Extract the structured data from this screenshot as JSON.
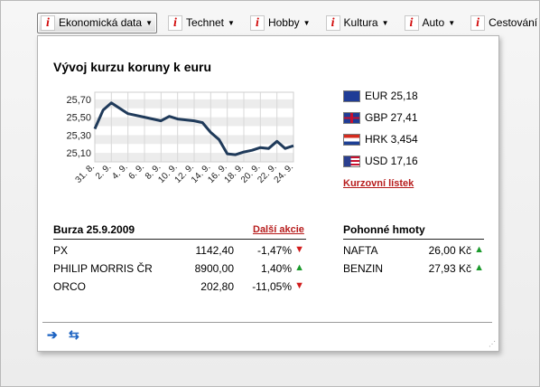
{
  "toolbar": {
    "items": [
      {
        "label": "Ekonomická data",
        "active": true
      },
      {
        "label": "Technet"
      },
      {
        "label": "Hobby"
      },
      {
        "label": "Kultura"
      },
      {
        "label": "Auto"
      },
      {
        "label": "Cestování"
      }
    ],
    "dropdown_glyph": "▼",
    "badge_glyph": "i"
  },
  "panel": {
    "title": "Vývoj kurzu koruny k euru",
    "chart_data": {
      "type": "line",
      "title": "Vývoj kurzu koruny k euru",
      "categories": [
        "31. 8.",
        "2. 9.",
        "4. 9.",
        "6. 9.",
        "8. 9.",
        "10. 9.",
        "12. 9.",
        "14. 9.",
        "16. 9.",
        "18. 9.",
        "20. 9.",
        "22. 9.",
        "24. 9."
      ],
      "x": [
        31,
        32,
        33,
        35,
        37,
        39,
        40,
        41,
        43,
        44,
        45,
        46,
        47,
        48,
        49,
        50,
        51,
        52,
        53,
        54,
        55
      ],
      "series": [
        {
          "values": [
            25.37,
            25.58,
            25.66,
            25.54,
            25.5,
            25.46,
            25.51,
            25.48,
            25.46,
            25.44,
            25.33,
            25.25,
            25.09,
            25.08,
            25.11,
            25.13,
            25.16,
            25.15,
            25.23,
            25.15,
            25.18
          ]
        }
      ],
      "y_ticks": [
        "25,70",
        "25,50",
        "25,30",
        "25,10"
      ],
      "ylim": [
        25.0,
        25.78
      ],
      "grid": true,
      "color": "#1f3a5a"
    },
    "currencies": [
      {
        "flag": "eu-flag",
        "text": "EUR 25,18"
      },
      {
        "flag": "gb-flag",
        "text": "GBP 27,41"
      },
      {
        "flag": "hr-flag",
        "text": "HRK 3,454"
      },
      {
        "flag": "us-flag",
        "text": "USD 17,16"
      }
    ],
    "currency_link": "Kurzovní lístek",
    "stocks": {
      "title": "Burza 25.9.2009",
      "more_link": "Další akcie",
      "rows": [
        {
          "name": "PX",
          "value": "1142,40",
          "change": "-1,47%",
          "dir": "down"
        },
        {
          "name": "PHILIP MORRIS ČR",
          "value": "8900,00",
          "change": "1,40%",
          "dir": "up"
        },
        {
          "name": "ORCO",
          "value": "202,80",
          "change": "-11,05%",
          "dir": "down"
        }
      ]
    },
    "fuels": {
      "title": "Pohonné hmoty",
      "rows": [
        {
          "name": "NAFTA",
          "value": "26,00 Kč",
          "dir": "up"
        },
        {
          "name": "BENZIN",
          "value": "27,93 Kč",
          "dir": "up"
        }
      ]
    },
    "footer": {
      "arrow_glyph": "➔",
      "refresh_glyph": "⇆"
    },
    "arrows": {
      "up": "▲",
      "down": "▼"
    },
    "colors": {
      "accent_link": "#b71c1c",
      "up": "#1b9a2c",
      "down": "#d11b1b"
    }
  }
}
